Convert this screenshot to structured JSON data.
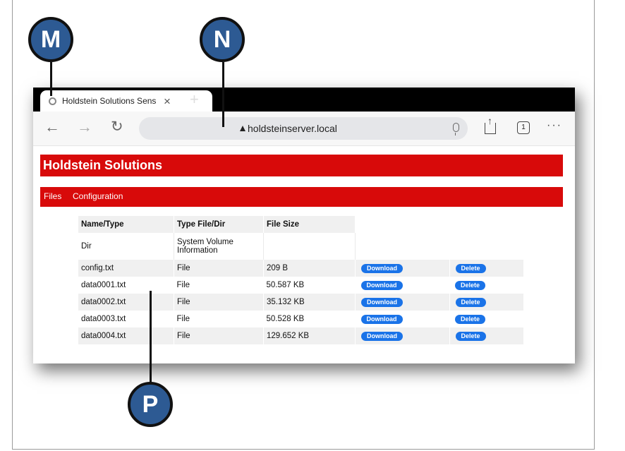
{
  "browser": {
    "tab_title": "Holdstein Solutions Sens",
    "tab_close": "×",
    "new_tab": "+",
    "url": "holdsteinserver.local",
    "tab_count": "1",
    "more": "···"
  },
  "page": {
    "banner_title": "Holdstein Solutions",
    "menu": {
      "files": "Files",
      "configuration": "Configuration"
    },
    "table": {
      "headers": [
        "Name/Type",
        "Type File/Dir",
        "File Size"
      ],
      "dir_row": {
        "name": "Dir",
        "type": "System Volume Information",
        "size": ""
      },
      "download_label": "Download",
      "delete_label": "Delete",
      "rows": [
        {
          "name": "config.txt",
          "type": "File",
          "size": "209 B"
        },
        {
          "name": "data0001.txt",
          "type": "File",
          "size": "50.587 KB"
        },
        {
          "name": "data0002.txt",
          "type": "File",
          "size": "35.132 KB"
        },
        {
          "name": "data0003.txt",
          "type": "File",
          "size": "50.528 KB"
        },
        {
          "name": "data0004.txt",
          "type": "File",
          "size": "129.652 KB"
        }
      ]
    }
  },
  "callouts": {
    "m": "M",
    "n": "N",
    "p": "P"
  },
  "colors": {
    "brand_red": "#d80a0a",
    "button_blue": "#1a73e8",
    "callout_blue": "#2d5a93"
  }
}
